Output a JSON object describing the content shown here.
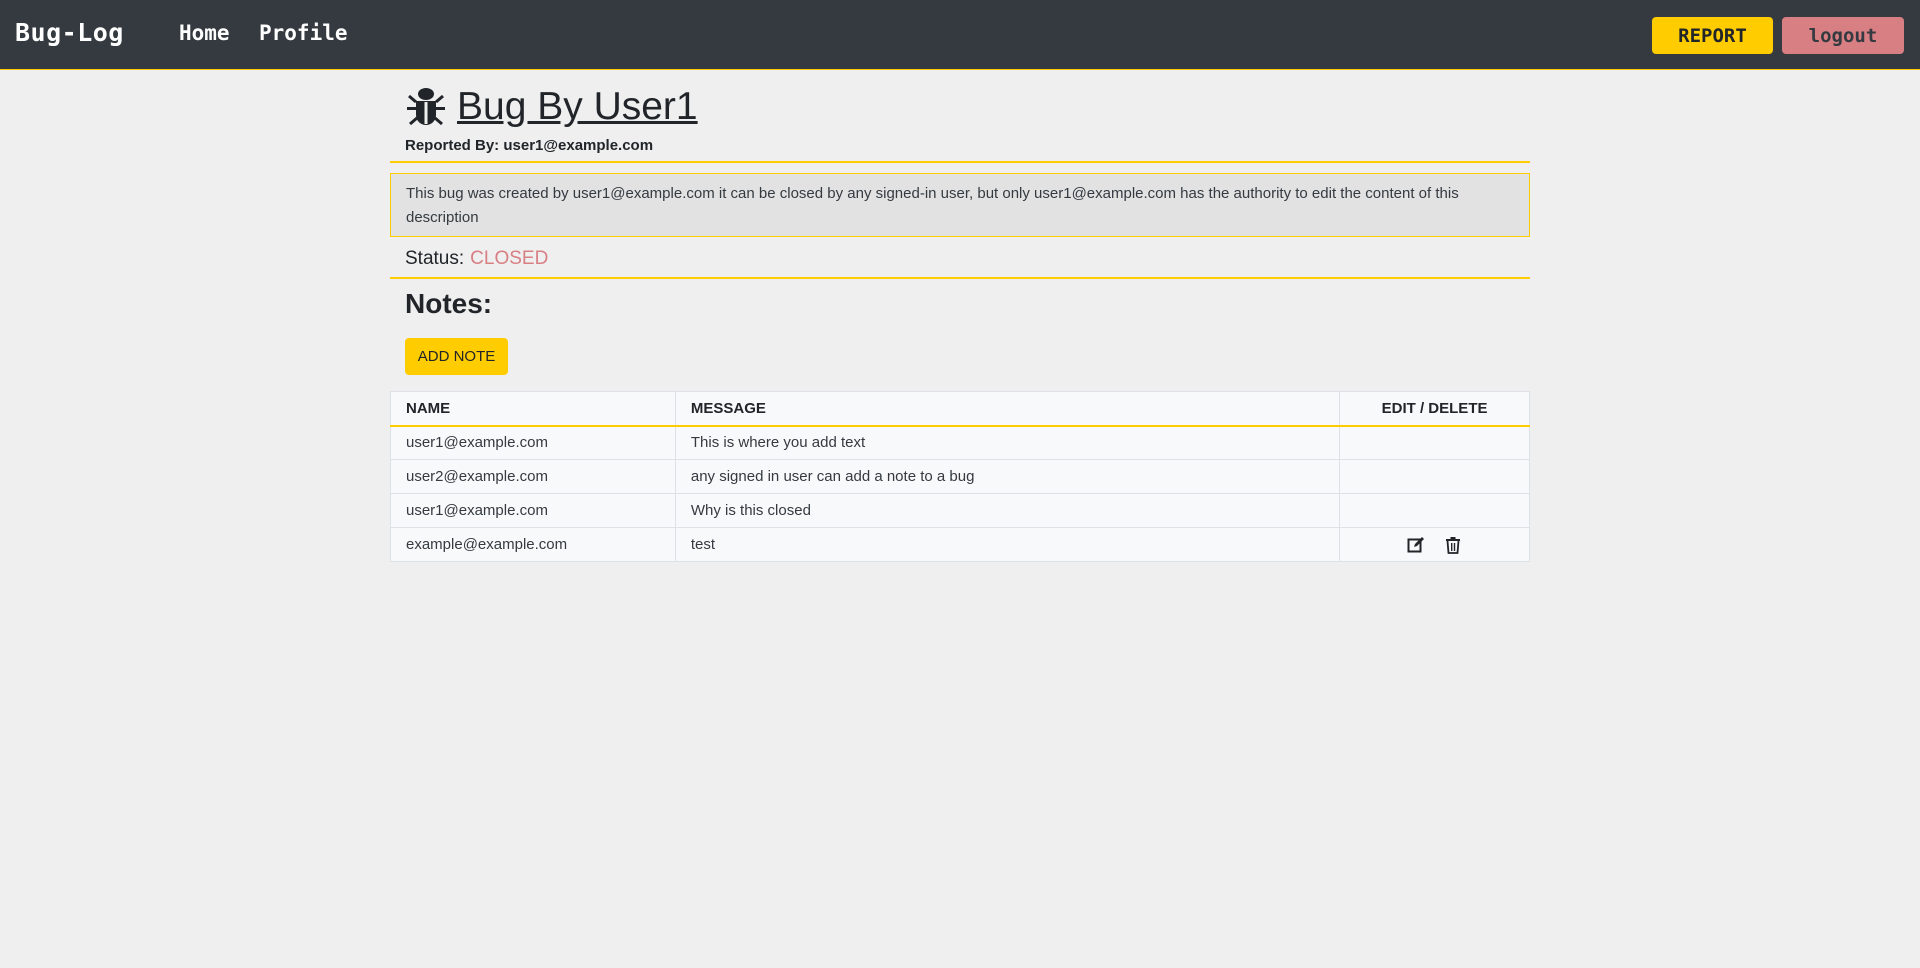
{
  "navbar": {
    "brand": "Bug-Log",
    "links": {
      "home": "Home",
      "profile": "Profile"
    },
    "report_button": "REPORT",
    "logout_button": "logout"
  },
  "bug": {
    "title": "Bug By User1",
    "reported_by_label": "Reported By:",
    "reported_by": "user1@example.com",
    "description": "This bug was created by user1@example.com it can be closed by any signed-in user, but only user1@example.com has the authority to edit the content of this description",
    "status_label": "Status:",
    "status": "CLOSED"
  },
  "notes": {
    "heading": "Notes:",
    "add_button": "ADD NOTE",
    "columns": [
      "NAME",
      "MESSAGE",
      "EDIT / DELETE"
    ],
    "rows": [
      {
        "name": "user1@example.com",
        "message": "This is where you add text",
        "editable": false
      },
      {
        "name": "user2@example.com",
        "message": "any signed in user can add a note to a bug",
        "editable": false
      },
      {
        "name": "user1@example.com",
        "message": "Why is this closed",
        "editable": false
      },
      {
        "name": "example@example.com",
        "message": "test",
        "editable": true
      }
    ]
  },
  "colors": {
    "navbar_bg": "#343a40",
    "accent_yellow": "#ffcc00",
    "logout_pink": "#d87f83",
    "status_closed": "#d87f83",
    "page_bg": "#efefef"
  },
  "icons": {
    "title_icon": "bug-icon",
    "edit_icon": "edit-icon",
    "delete_icon": "trash-icon"
  }
}
